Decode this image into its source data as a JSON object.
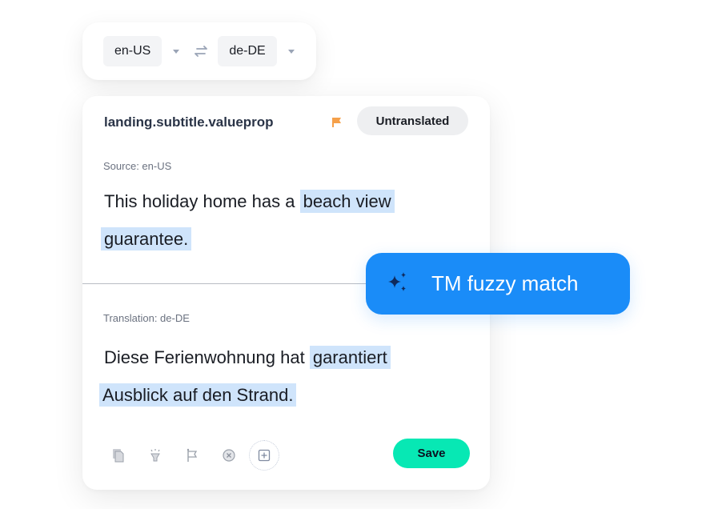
{
  "language_bar": {
    "source_lang": "en-US",
    "target_lang": "de-DE",
    "swap_icon": "swap-arrows-icon",
    "dropdown_icon": "caret-down-icon"
  },
  "card": {
    "string_key": "landing.subtitle.valueprop",
    "flag_icon": "flag-icon",
    "flag_color": "#f5a04a",
    "status": "Untranslated",
    "source": {
      "label": "Source: en-US",
      "line1_plain": "This holiday home has a ",
      "line1_highlight": "beach view",
      "line2_highlight": "guarantee."
    },
    "translation": {
      "label": "Translation: de-DE",
      "line1_plain": "Diese Ferienwohnung hat ",
      "line1_highlight": "garantiert",
      "line2_highlight": "Ausblick auf den Strand."
    },
    "toolbar": {
      "icons": [
        "copy-icon",
        "lightbulb-icon",
        "flag-outline-icon",
        "clear-icon",
        "add-icon"
      ]
    },
    "save_label": "Save",
    "highlight_color": "#cfe4fb",
    "save_color": "#07e8b4"
  },
  "tm_badge": {
    "label": "TM fuzzy match",
    "icon": "sparkle-icon",
    "color": "#1a8cf8"
  }
}
